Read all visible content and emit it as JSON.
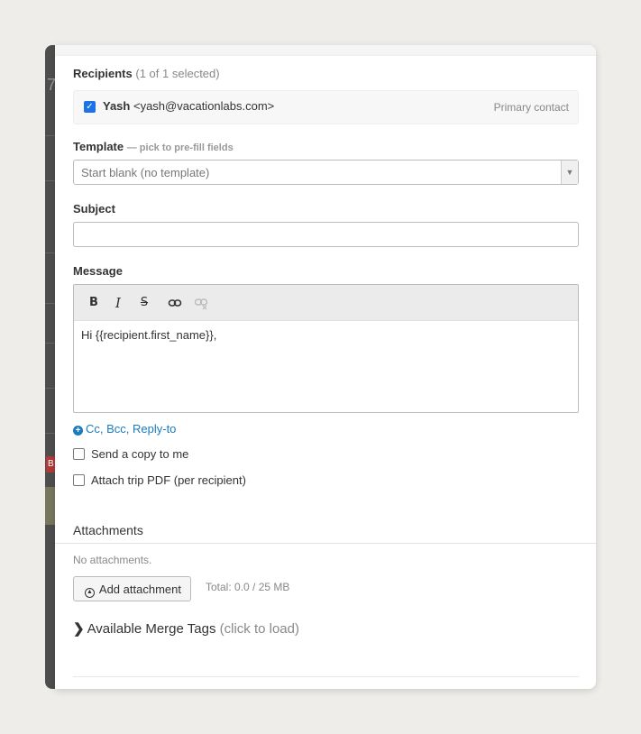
{
  "backdrop": {
    "seven": "7",
    "badge": "B"
  },
  "recipients": {
    "label": "Recipients",
    "count": "(1 of 1 selected)",
    "items": [
      {
        "name": "Yash",
        "email": "<yash@vacationlabs.com>",
        "tag": "Primary contact",
        "checked": true
      }
    ]
  },
  "template": {
    "label": "Template",
    "hint": "— pick to pre-fill fields",
    "selected": "Start blank (no template)"
  },
  "subject": {
    "label": "Subject",
    "value": ""
  },
  "message": {
    "label": "Message",
    "toolbar": {
      "bold": "B",
      "italic": "I",
      "strike": "S"
    },
    "body": "Hi {{recipient.first_name}},"
  },
  "cc_link": "Cc, Bcc, Reply-to",
  "options": {
    "send_copy": "Send a copy to me",
    "attach_pdf": "Attach trip PDF (per recipient)"
  },
  "attachments": {
    "title": "Attachments",
    "empty": "No attachments.",
    "add_label": "Add attachment",
    "total": "Total: 0.0 / 25 MB"
  },
  "merge_tags": {
    "label": "Available Merge Tags",
    "hint": "(click to load)"
  },
  "colors": {
    "link": "#1a7bc0",
    "checkbox": "#1a73e8"
  }
}
